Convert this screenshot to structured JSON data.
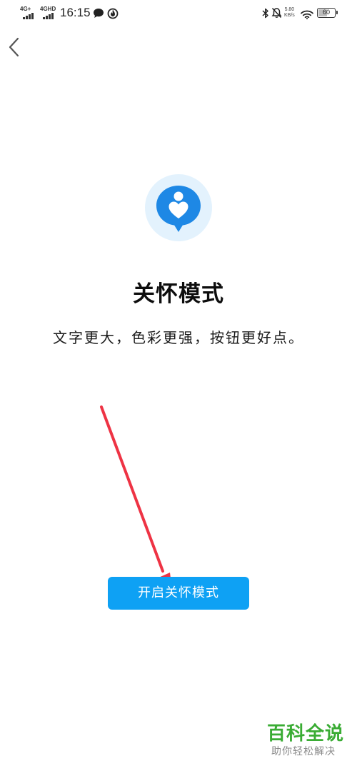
{
  "status_bar": {
    "sim1_network": "4G+",
    "sim2_network": "4GHD",
    "time": "16:15",
    "network_speed_value": "5.80",
    "network_speed_unit": "KB/s",
    "battery_level": "60",
    "battery_fraction": 0.6
  },
  "nav": {
    "back_icon": "chevron-left-icon"
  },
  "main": {
    "icon": "care-person-heart-icon",
    "title": "关怀模式",
    "subtitle": "文字更大，色彩更强，按钮更好点。",
    "enable_button_label": "开启关怀模式"
  },
  "colors": {
    "accent": "#0ea1f4",
    "icon_bg": "#e3f2fd",
    "annotation": "#ee3344",
    "watermark": "#3aac34"
  },
  "watermark": {
    "title": "百科全说",
    "subtitle": "助你轻松解决"
  }
}
